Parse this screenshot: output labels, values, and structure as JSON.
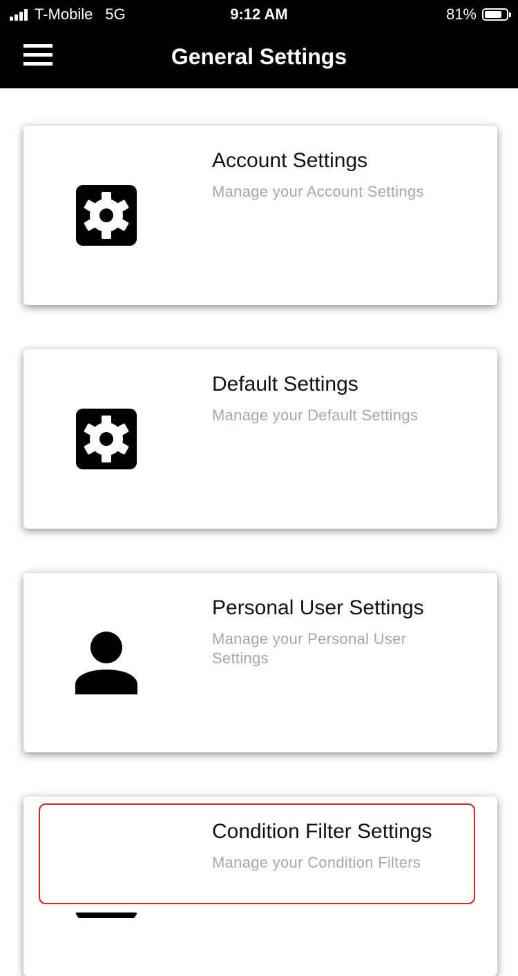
{
  "status_bar": {
    "carrier": "T-Mobile",
    "network": "5G",
    "time": "9:12 AM",
    "battery_percent_text": "81%",
    "battery_level": 0.81,
    "signal_icon": "cellular-signal-icon",
    "battery_icon": "battery-icon"
  },
  "header": {
    "title": "General Settings",
    "menu_icon": "hamburger-menu-icon"
  },
  "settings_cards": [
    {
      "title": "Account Settings",
      "subtitle": "Manage your Account Settings",
      "icon": "gear-icon"
    },
    {
      "title": "Default Settings",
      "subtitle": "Manage your Default Settings",
      "icon": "gear-icon"
    },
    {
      "title": "Personal User Settings",
      "subtitle": "Manage your Personal User Settings",
      "icon": "person-icon"
    },
    {
      "title": "Condition Filter Settings",
      "subtitle": "Manage your Condition Filters",
      "icon": "filter-funnel-icon",
      "highlighted": true
    }
  ],
  "colors": {
    "header_background": "#000000",
    "header_text": "#ffffff",
    "card_background": "#ffffff",
    "subtitle_text": "#a3a7b2",
    "highlight_border": "#e02020"
  }
}
